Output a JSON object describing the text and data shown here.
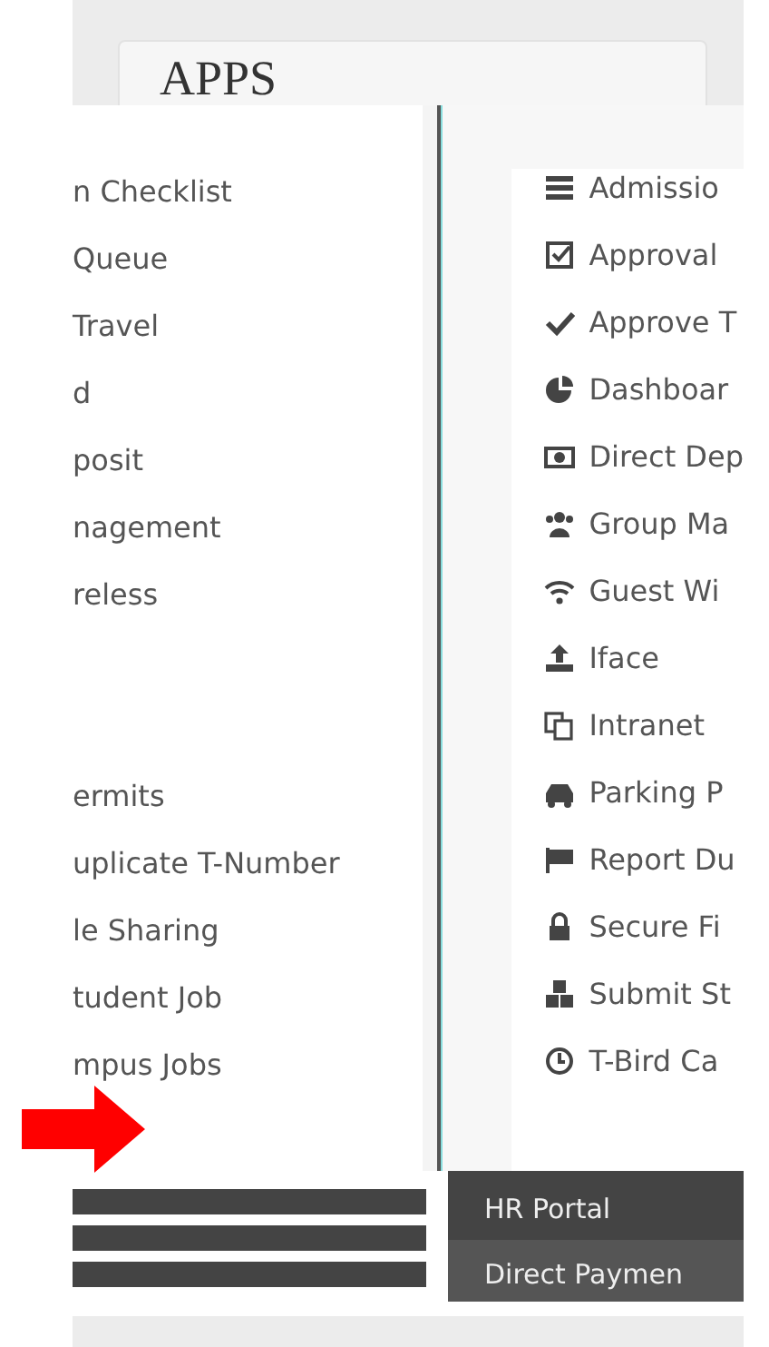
{
  "header": {
    "title": "APPS"
  },
  "left_column": {
    "groups": [
      [
        "n Checklist",
        "Queue",
        "Travel",
        "d",
        "posit",
        "nagement",
        "reless"
      ],
      [
        "ermits",
        "uplicate T-Number",
        "le Sharing",
        "tudent Job",
        "mpus Jobs"
      ]
    ]
  },
  "right_column": {
    "items": [
      "Admissio",
      "Approval",
      "Approve T",
      "Dashboar",
      "Direct Dep",
      "Group Ma",
      "Guest Wi",
      "Iface",
      "Intranet",
      "Parking P",
      "Report Du",
      "Secure Fi",
      "Submit St",
      "T-Bird Ca"
    ]
  },
  "bottom_bars": [
    "HR Portal",
    "Direct Paymen"
  ]
}
